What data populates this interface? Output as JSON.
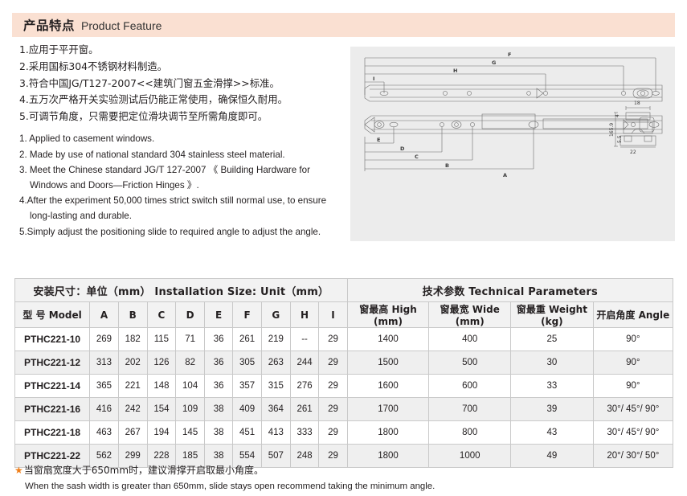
{
  "header": {
    "title_cn": "产品特点",
    "title_en": "Product Feature",
    "bar_color": "#fae0d2"
  },
  "features": {
    "chinese": [
      "1.应用于平开窗。",
      "2.采用国标304不锈钢材料制造。",
      "3.符合中国JG/T127-2007<<建筑门窗五金滑撑>>标准。",
      "4.五万次严格开关实验测试后仍能正常使用，确保恒久耐用。",
      "5.可调节角度，只需要把定位滑块调节至所需角度即可。"
    ],
    "english": [
      "1. Applied to casement windows.",
      "2. Made by use of national standard 304 stainless steel material.",
      "3. Meet the Chinese standard JG/T 127-2007 《 Building Hardware for Windows and Doors—Friction Hinges 》.",
      "4.After the experiment 50,000 times strict switch still normal use, to ensure long-lasting and durable.",
      "5.Simply adjust the positioning slide to required angle to adjust the angle."
    ]
  },
  "drawing": {
    "background": "#ececec",
    "dimension_labels": [
      "F",
      "G",
      "H",
      "I",
      "E",
      "D",
      "C",
      "B",
      "A"
    ],
    "section_dims": [
      "18",
      "4",
      "5.5",
      "165.9",
      "22"
    ],
    "section_tolerances": [
      "+0.5",
      "+0.3",
      "0"
    ]
  },
  "table": {
    "group_headers": [
      {
        "label": "安装尺寸：单位（mm） Installation Size: Unit（mm）",
        "span": 10
      },
      {
        "label": "技术参数  Technical Parameters",
        "span": 4
      }
    ],
    "columns": [
      "型 号 Model",
      "A",
      "B",
      "C",
      "D",
      "E",
      "F",
      "G",
      "H",
      "I",
      "窗最高 High (mm)",
      "窗最宽 Wide (mm)",
      "窗最重 Weight (kg)",
      "开启角度 Angle"
    ],
    "rows": [
      [
        "PTHC221-10",
        "269",
        "182",
        "115",
        "71",
        "36",
        "261",
        "219",
        "--",
        "29",
        "1400",
        "400",
        "25",
        "90°"
      ],
      [
        "PTHC221-12",
        "313",
        "202",
        "126",
        "82",
        "36",
        "305",
        "263",
        "244",
        "29",
        "1500",
        "500",
        "30",
        "90°"
      ],
      [
        "PTHC221-14",
        "365",
        "221",
        "148",
        "104",
        "36",
        "357",
        "315",
        "276",
        "29",
        "1600",
        "600",
        "33",
        "90°"
      ],
      [
        "PTHC221-16",
        "416",
        "242",
        "154",
        "109",
        "38",
        "409",
        "364",
        "261",
        "29",
        "1700",
        "700",
        "39",
        "30°/ 45°/ 90°"
      ],
      [
        "PTHC221-18",
        "463",
        "267",
        "194",
        "145",
        "38",
        "451",
        "413",
        "333",
        "29",
        "1800",
        "800",
        "43",
        "30°/ 45°/ 90°"
      ],
      [
        "PTHC221-22",
        "562",
        "299",
        "228",
        "185",
        "38",
        "554",
        "507",
        "248",
        "29",
        "1800",
        "1000",
        "49",
        "20°/ 30°/ 50°"
      ]
    ]
  },
  "note": {
    "star": "★",
    "star_color": "#f07f1a",
    "chinese": "当窗扇宽度大于650mm时，建议滑撑开启取最小角度。",
    "english": "When the sash width is greater than 650mm, slide stays open recommend taking the minimum angle."
  }
}
